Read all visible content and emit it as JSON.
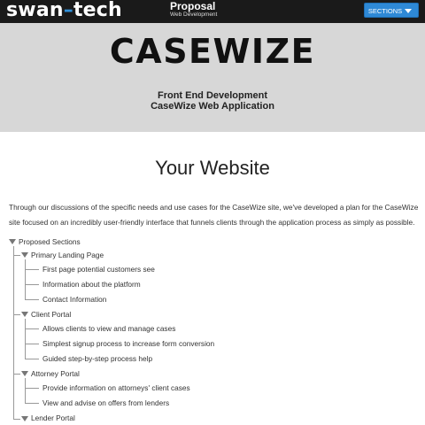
{
  "header": {
    "logo": {
      "part1": "swan",
      "dash": "–",
      "part2": "tech"
    },
    "title": "Proposal",
    "subtitle": "Web Development",
    "sections_button": "SECTIONS"
  },
  "hero": {
    "brand": "CASEWIZE",
    "line1": "Front End Development",
    "line2": "CaseWize Web Application"
  },
  "main": {
    "title": "Your Website",
    "intro": "Through our discussions of the specific needs and use cases for the CaseWize site, we've developed a plan for the CaseWize site focused on an incredibly user-friendly interface that funnels clients through the application process as simply as possible.",
    "tree": {
      "root": "Proposed Sections",
      "groups": [
        {
          "label": "Primary Landing Page",
          "items": [
            "First page potential customers see",
            "Information about the platform",
            "Contact Information"
          ]
        },
        {
          "label": "Client Portal",
          "items": [
            "Allows clients to view and manage cases",
            "Simplest signup process to increase form conversion",
            "Guided step-by-step process help"
          ]
        },
        {
          "label": "Attorney Portal",
          "items": [
            "Provide information on attorneys' client cases",
            "View and advise on offers from lenders"
          ]
        },
        {
          "label": "Lender Portal",
          "items": []
        }
      ]
    }
  }
}
